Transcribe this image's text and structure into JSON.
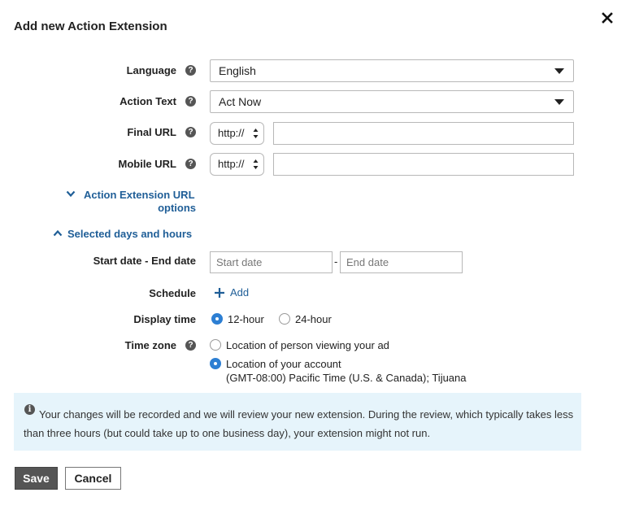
{
  "dialog": {
    "title": "Add new Action Extension",
    "close_icon": "close-icon"
  },
  "form": {
    "language": {
      "label": "Language",
      "help_icon": "help-icon",
      "selected": "English"
    },
    "action_text": {
      "label": "Action Text",
      "help_icon": "help-icon",
      "selected": "Act Now"
    },
    "final_url": {
      "label": "Final URL",
      "help_icon": "help-icon",
      "protocol": "http://",
      "value": ""
    },
    "mobile_url": {
      "label": "Mobile URL",
      "help_icon": "help-icon",
      "protocol": "http://",
      "value": ""
    },
    "url_options_link": {
      "line1": "Action Extension URL",
      "line2": "options",
      "icon": "chevron-down-icon"
    },
    "days_hours_link": {
      "label": "Selected days and hours",
      "icon": "chevron-up-icon"
    },
    "date_range": {
      "label": "Start date - End date",
      "start_placeholder": "Start date",
      "separator": "-",
      "end_placeholder": "End date"
    },
    "schedule": {
      "label": "Schedule",
      "add_label": "Add",
      "add_icon": "plus-icon"
    },
    "display_time": {
      "label": "Display time",
      "options": [
        {
          "label": "12-hour",
          "checked": true
        },
        {
          "label": "24-hour",
          "checked": false
        }
      ]
    },
    "time_zone": {
      "label": "Time zone",
      "help_icon": "help-icon",
      "options": [
        {
          "label": "Location of person viewing your ad",
          "checked": false
        },
        {
          "label": "Location of your account",
          "sublabel": "(GMT-08:00) Pacific Time (U.S. & Canada); Tijuana",
          "checked": true
        }
      ]
    }
  },
  "notice": {
    "icon": "info-icon",
    "text": "Your changes will be recorded and we will review your new extension. During the review, which typically takes less than three hours (but could take up to one business day), your extension might not run."
  },
  "buttons": {
    "save": "Save",
    "cancel": "Cancel"
  },
  "colors": {
    "link": "#1f5e97",
    "radio_checked": "#2d7fd3",
    "notice_bg": "#e6f4fb",
    "save_bg": "#555555"
  }
}
